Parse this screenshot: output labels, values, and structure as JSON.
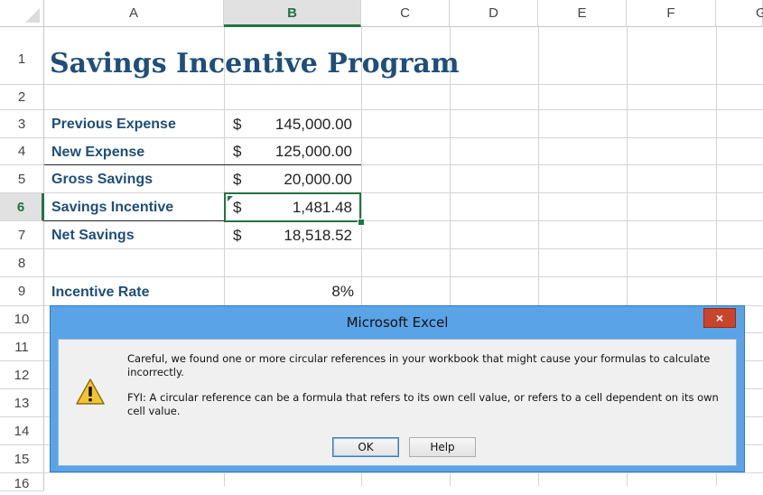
{
  "columns": [
    "A",
    "B",
    "C",
    "D",
    "E",
    "F",
    "G"
  ],
  "rows": [
    "1",
    "2",
    "3",
    "4",
    "5",
    "6",
    "7",
    "8",
    "9",
    "10",
    "11",
    "12",
    "13",
    "14",
    "15",
    "16"
  ],
  "selected_cell": "B6",
  "cells": {
    "A1": "Savings Incentive Program",
    "A3": "Previous Expense",
    "A4": "New Expense",
    "A5": "Gross Savings",
    "A6": "Savings Incentive",
    "A7": "Net Savings",
    "A9": "Incentive Rate",
    "B3": {
      "symbol": "$",
      "amount": "145,000.00"
    },
    "B4": {
      "symbol": "$",
      "amount": "125,000.00"
    },
    "B5": {
      "symbol": "$",
      "amount": "20,000.00"
    },
    "B6": {
      "symbol": "$",
      "amount": "1,481.48"
    },
    "B7": {
      "symbol": "$",
      "amount": "18,518.52"
    },
    "B9": "8%"
  },
  "dialog": {
    "title": "Microsoft Excel",
    "close_label": "×",
    "message_1": "Careful, we found one or more circular references in your workbook that might cause your formulas to calculate incorrectly.",
    "message_2": "FYI: A circular reference can be a formula that refers to its own cell value, or refers to a cell dependent on its own cell value.",
    "ok_label": "OK",
    "help_label": "Help",
    "icon": "warning-icon"
  },
  "colors": {
    "accent_green": "#217346",
    "label_blue": "#1f4e79",
    "dialog_frame": "#5aa3e6",
    "close_red": "#c7452b"
  }
}
